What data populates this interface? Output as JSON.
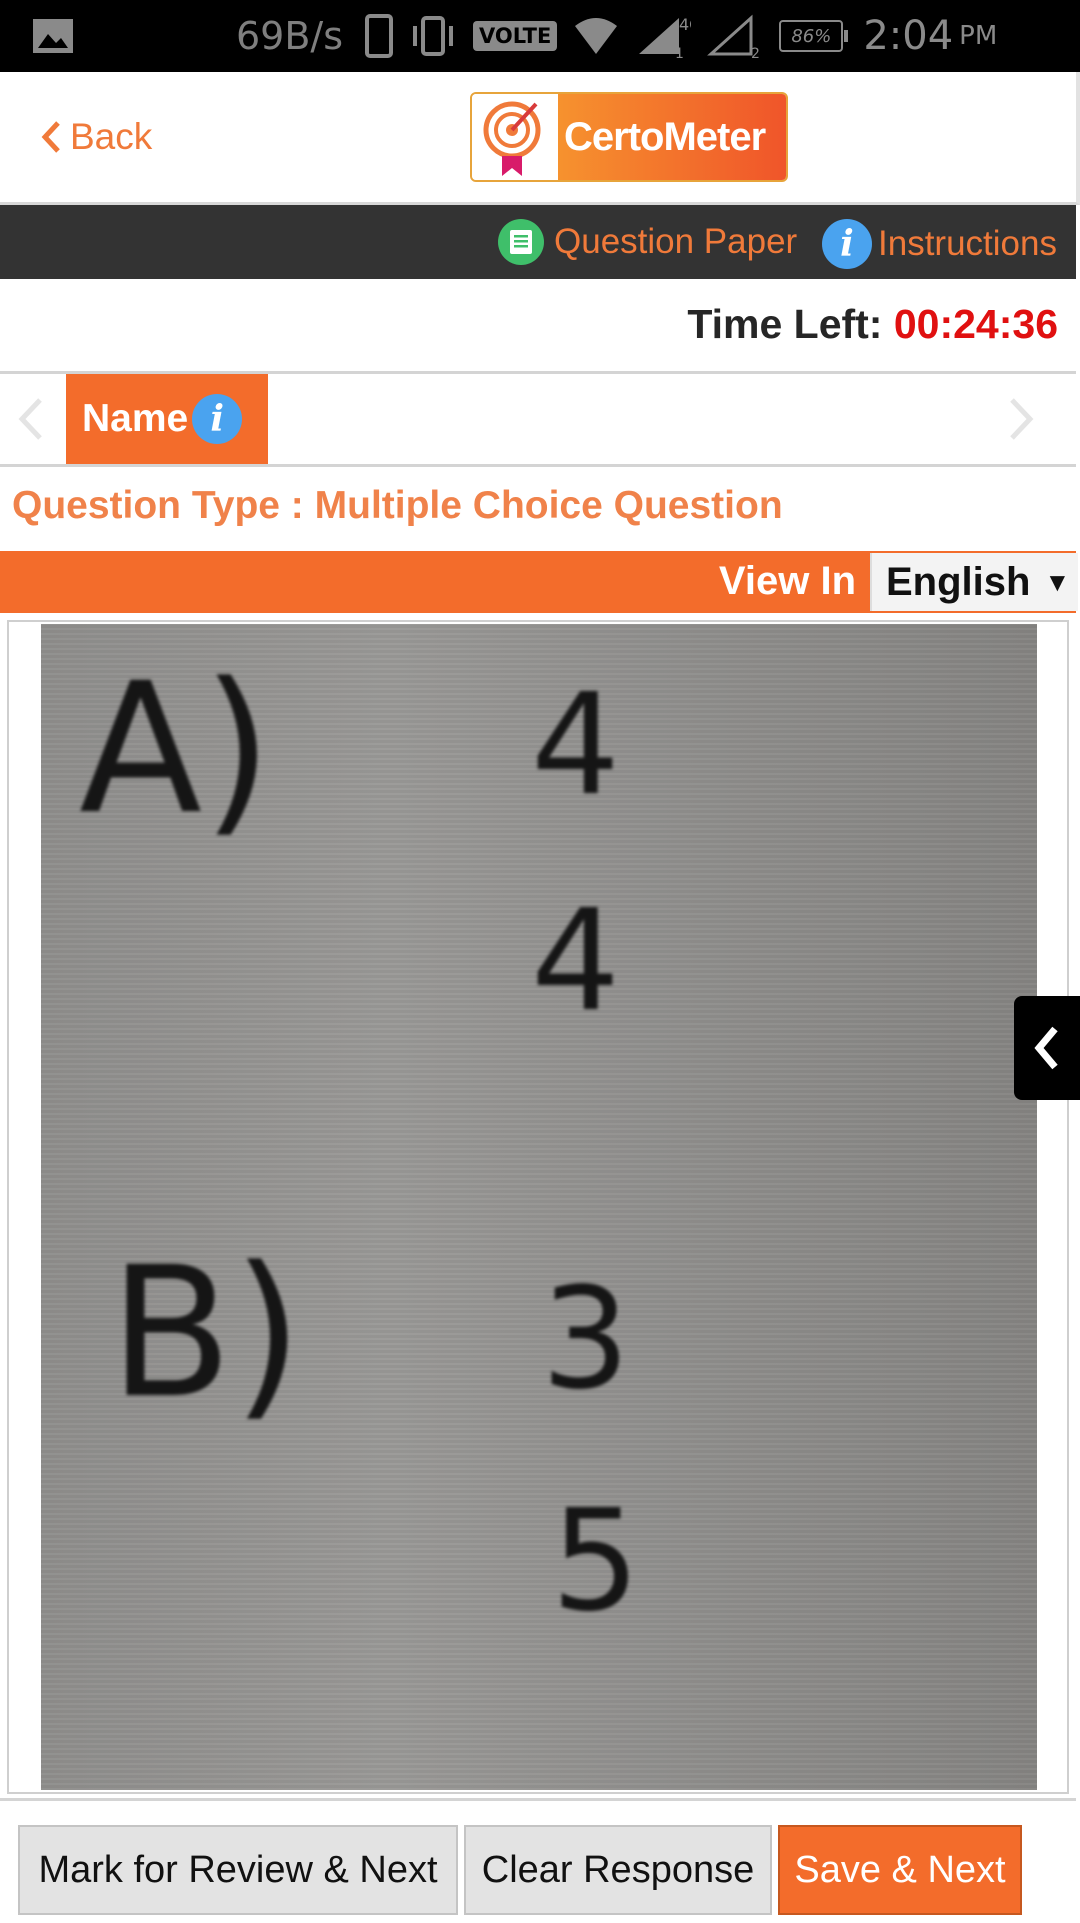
{
  "status_bar": {
    "speed": "69B/s",
    "volte": "VOLTE",
    "network": "4G",
    "sim1": "1",
    "sim2": "2",
    "battery": "86%",
    "time": "2:04",
    "ampm": "PM"
  },
  "header": {
    "back_label": "Back",
    "logo_text": "CertoMeter"
  },
  "toolbar": {
    "question_paper": "Question Paper",
    "instructions": "Instructions",
    "info_glyph": "i"
  },
  "timer": {
    "label": "Time Left:",
    "value": "00:24:36"
  },
  "section_tabs": {
    "active": "Name",
    "info_glyph": "i"
  },
  "question": {
    "type_label": "Question Type : Multiple Choice Question",
    "view_in_label": "View In",
    "language": "English",
    "language_arrow": "▼",
    "image_options": [
      {
        "letter": "A)",
        "numerator": "4",
        "denominator": "4"
      },
      {
        "letter": "B)",
        "numerator": "3",
        "denominator": "5"
      }
    ]
  },
  "buttons": {
    "mark_review": "Mark for Review & Next",
    "clear": "Clear Response",
    "save_next": "Save & Next"
  },
  "colors": {
    "accent": "#f36c2b",
    "toolbar_bg": "#333333",
    "timer_value": "#e01010",
    "info_blue": "#4aa3ef",
    "qp_green": "#3fbf6a"
  },
  "icons": [
    "gallery-icon",
    "vibrate-icon",
    "wifi-icon",
    "signal-icon",
    "battery-icon",
    "back-chevron-icon",
    "question-paper-icon",
    "info-icon",
    "chevron-left-icon",
    "chevron-right-icon",
    "drawer-toggle-icon"
  ]
}
